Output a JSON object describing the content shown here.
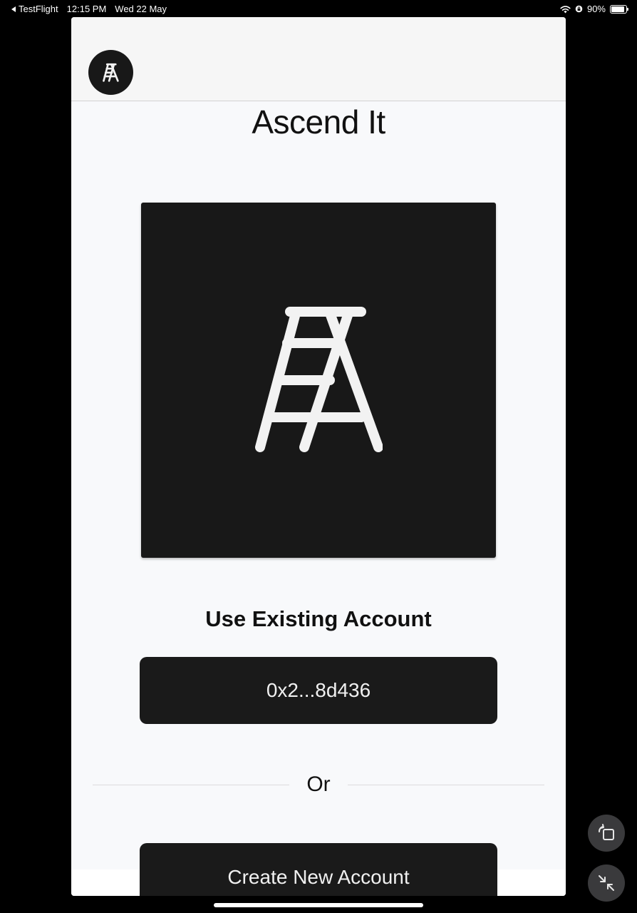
{
  "status_bar": {
    "back_app": "TestFlight",
    "time": "12:15 PM",
    "date": "Wed 22 May",
    "battery": "90%",
    "battery_level": 0.9
  },
  "app": {
    "title": "Ascend It",
    "use_existing_heading": "Use Existing Account",
    "account_address": "0x2...8d436",
    "divider_text": "Or",
    "create_account_label": "Create New Account"
  },
  "icons": {
    "avatar": "ladder-icon",
    "logo": "ladder-icon",
    "rotate": "rotate-screen-icon",
    "shrink": "shrink-arrows-icon"
  },
  "colors": {
    "button_bg": "#1a1a1a",
    "page_bg": "#f8f9fb",
    "logo_bg": "#181818",
    "ladder": "#f2f2f2"
  }
}
